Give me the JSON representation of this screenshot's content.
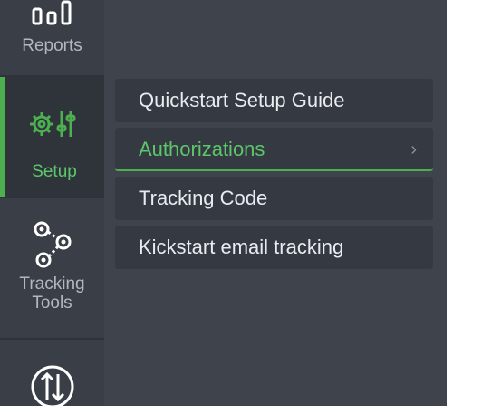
{
  "rail": {
    "items": [
      {
        "label": "Reports",
        "icon": "bar-chart-icon"
      },
      {
        "label": "Setup",
        "icon": "gear-sliders-icon",
        "active": true
      },
      {
        "label": "Tracking Tools",
        "icon": "tracking-nodes-icon"
      },
      {
        "label": "",
        "icon": "up-down-arrows-icon"
      }
    ]
  },
  "submenu": {
    "items": [
      {
        "label": "Quickstart Setup Guide"
      },
      {
        "label": "Authorizations",
        "active": true,
        "has_submenu": true
      },
      {
        "label": "Tracking Code"
      },
      {
        "label": "Kickstart email tracking"
      }
    ]
  },
  "colors": {
    "rail_bg": "#3a3f47",
    "panel_bg": "#3f444c",
    "item_bg": "#353a42",
    "accent_green": "#5cc66b",
    "text_light": "#e9ecef",
    "text_muted": "#b3b8bf"
  }
}
